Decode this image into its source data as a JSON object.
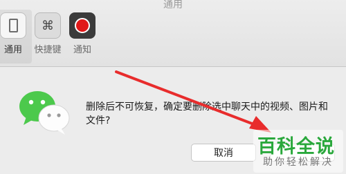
{
  "window": {
    "title": "通用"
  },
  "toolbar": {
    "items": [
      {
        "label": "通用",
        "icon": "general-icon",
        "selected": true
      },
      {
        "label": "快捷键",
        "icon": "command-key-icon",
        "selected": false
      },
      {
        "label": "通知",
        "icon": "notification-icon",
        "selected": false
      }
    ],
    "command_glyph": "⌘"
  },
  "dialog": {
    "icon": "wechat-icon",
    "message": "删除后不可恢复，确定要删除选中聊天中的视频、图片和文件?",
    "cancel_label": "取消"
  },
  "annotation": {
    "arrow_color": "#e82c2c"
  },
  "watermark": {
    "main": "百科全说",
    "sub": "助你轻松解决"
  },
  "colors": {
    "wechat_green": "#4cc94c",
    "notify_red": "#e01818",
    "watermark_green": "#2aa83c"
  }
}
